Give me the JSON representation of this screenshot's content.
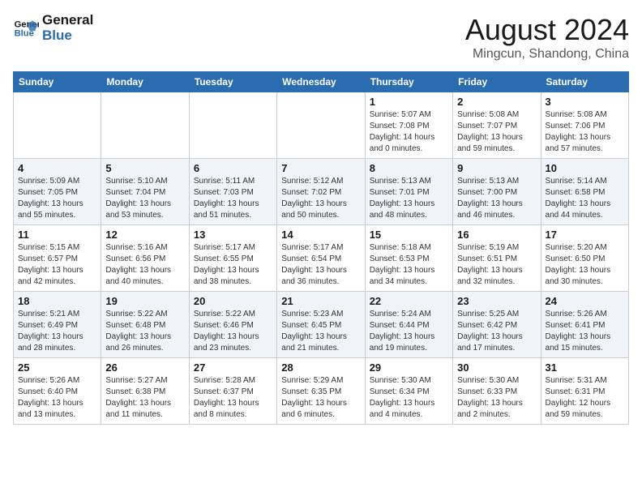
{
  "logo": {
    "line1": "General",
    "line2": "Blue"
  },
  "title": "August 2024",
  "location": "Mingcun, Shandong, China",
  "days_of_week": [
    "Sunday",
    "Monday",
    "Tuesday",
    "Wednesday",
    "Thursday",
    "Friday",
    "Saturday"
  ],
  "weeks": [
    [
      {
        "day": "",
        "info": ""
      },
      {
        "day": "",
        "info": ""
      },
      {
        "day": "",
        "info": ""
      },
      {
        "day": "",
        "info": ""
      },
      {
        "day": "1",
        "info": "Sunrise: 5:07 AM\nSunset: 7:08 PM\nDaylight: 14 hours\nand 0 minutes."
      },
      {
        "day": "2",
        "info": "Sunrise: 5:08 AM\nSunset: 7:07 PM\nDaylight: 13 hours\nand 59 minutes."
      },
      {
        "day": "3",
        "info": "Sunrise: 5:08 AM\nSunset: 7:06 PM\nDaylight: 13 hours\nand 57 minutes."
      }
    ],
    [
      {
        "day": "4",
        "info": "Sunrise: 5:09 AM\nSunset: 7:05 PM\nDaylight: 13 hours\nand 55 minutes."
      },
      {
        "day": "5",
        "info": "Sunrise: 5:10 AM\nSunset: 7:04 PM\nDaylight: 13 hours\nand 53 minutes."
      },
      {
        "day": "6",
        "info": "Sunrise: 5:11 AM\nSunset: 7:03 PM\nDaylight: 13 hours\nand 51 minutes."
      },
      {
        "day": "7",
        "info": "Sunrise: 5:12 AM\nSunset: 7:02 PM\nDaylight: 13 hours\nand 50 minutes."
      },
      {
        "day": "8",
        "info": "Sunrise: 5:13 AM\nSunset: 7:01 PM\nDaylight: 13 hours\nand 48 minutes."
      },
      {
        "day": "9",
        "info": "Sunrise: 5:13 AM\nSunset: 7:00 PM\nDaylight: 13 hours\nand 46 minutes."
      },
      {
        "day": "10",
        "info": "Sunrise: 5:14 AM\nSunset: 6:58 PM\nDaylight: 13 hours\nand 44 minutes."
      }
    ],
    [
      {
        "day": "11",
        "info": "Sunrise: 5:15 AM\nSunset: 6:57 PM\nDaylight: 13 hours\nand 42 minutes."
      },
      {
        "day": "12",
        "info": "Sunrise: 5:16 AM\nSunset: 6:56 PM\nDaylight: 13 hours\nand 40 minutes."
      },
      {
        "day": "13",
        "info": "Sunrise: 5:17 AM\nSunset: 6:55 PM\nDaylight: 13 hours\nand 38 minutes."
      },
      {
        "day": "14",
        "info": "Sunrise: 5:17 AM\nSunset: 6:54 PM\nDaylight: 13 hours\nand 36 minutes."
      },
      {
        "day": "15",
        "info": "Sunrise: 5:18 AM\nSunset: 6:53 PM\nDaylight: 13 hours\nand 34 minutes."
      },
      {
        "day": "16",
        "info": "Sunrise: 5:19 AM\nSunset: 6:51 PM\nDaylight: 13 hours\nand 32 minutes."
      },
      {
        "day": "17",
        "info": "Sunrise: 5:20 AM\nSunset: 6:50 PM\nDaylight: 13 hours\nand 30 minutes."
      }
    ],
    [
      {
        "day": "18",
        "info": "Sunrise: 5:21 AM\nSunset: 6:49 PM\nDaylight: 13 hours\nand 28 minutes."
      },
      {
        "day": "19",
        "info": "Sunrise: 5:22 AM\nSunset: 6:48 PM\nDaylight: 13 hours\nand 26 minutes."
      },
      {
        "day": "20",
        "info": "Sunrise: 5:22 AM\nSunset: 6:46 PM\nDaylight: 13 hours\nand 23 minutes."
      },
      {
        "day": "21",
        "info": "Sunrise: 5:23 AM\nSunset: 6:45 PM\nDaylight: 13 hours\nand 21 minutes."
      },
      {
        "day": "22",
        "info": "Sunrise: 5:24 AM\nSunset: 6:44 PM\nDaylight: 13 hours\nand 19 minutes."
      },
      {
        "day": "23",
        "info": "Sunrise: 5:25 AM\nSunset: 6:42 PM\nDaylight: 13 hours\nand 17 minutes."
      },
      {
        "day": "24",
        "info": "Sunrise: 5:26 AM\nSunset: 6:41 PM\nDaylight: 13 hours\nand 15 minutes."
      }
    ],
    [
      {
        "day": "25",
        "info": "Sunrise: 5:26 AM\nSunset: 6:40 PM\nDaylight: 13 hours\nand 13 minutes."
      },
      {
        "day": "26",
        "info": "Sunrise: 5:27 AM\nSunset: 6:38 PM\nDaylight: 13 hours\nand 11 minutes."
      },
      {
        "day": "27",
        "info": "Sunrise: 5:28 AM\nSunset: 6:37 PM\nDaylight: 13 hours\nand 8 minutes."
      },
      {
        "day": "28",
        "info": "Sunrise: 5:29 AM\nSunset: 6:35 PM\nDaylight: 13 hours\nand 6 minutes."
      },
      {
        "day": "29",
        "info": "Sunrise: 5:30 AM\nSunset: 6:34 PM\nDaylight: 13 hours\nand 4 minutes."
      },
      {
        "day": "30",
        "info": "Sunrise: 5:30 AM\nSunset: 6:33 PM\nDaylight: 13 hours\nand 2 minutes."
      },
      {
        "day": "31",
        "info": "Sunrise: 5:31 AM\nSunset: 6:31 PM\nDaylight: 12 hours\nand 59 minutes."
      }
    ]
  ]
}
